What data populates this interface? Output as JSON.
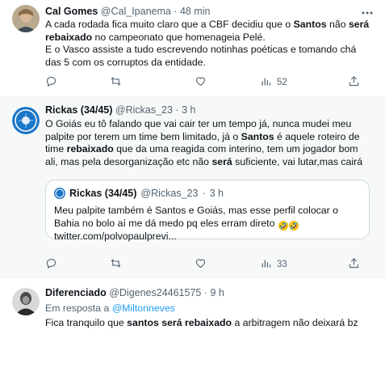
{
  "tweets": [
    {
      "name": "Cal Gomes",
      "handle": "@Cal_Ipanema",
      "sep": "·",
      "time": "48 min",
      "paragraphs": [
        [
          {
            "t": "A cada rodada fica muito claro que a CBF decidiu que o "
          },
          {
            "t": "Santos",
            "b": true
          },
          {
            "t": " não "
          },
          {
            "t": "será",
            "b": true
          },
          {
            "t": " "
          },
          {
            "t": "rebaixado",
            "b": true
          },
          {
            "t": " no campeonato que homenageia Pelé."
          }
        ],
        [
          {
            "t": "E o Vasco assiste a tudo escrevendo notinhas poéticas e tomando chá das 5 com os corruptos da entidade."
          }
        ]
      ],
      "counts": {
        "reply": "",
        "retweet": "",
        "like": "",
        "views": "52"
      }
    },
    {
      "name": "Rickas (34/45)",
      "handle": "@Rickas_23",
      "sep": "·",
      "time": "3 h",
      "paragraphs": [
        [
          {
            "t": "O Goiás eu tô falando que vai cair ter um tempo já, nunca mudei meu palpite por terem um time bem limitado, já o "
          },
          {
            "t": "Santos",
            "b": true
          },
          {
            "t": " é aquele roteiro de time "
          },
          {
            "t": "rebaixado",
            "b": true
          },
          {
            "t": " que da uma reagida com interino, tem um jogador bom ali, mas pela desorganização etc não "
          },
          {
            "t": "será",
            "b": true
          },
          {
            "t": " suficiente, vai lutar,mas cairá"
          }
        ]
      ],
      "quote": {
        "name": "Rickas (34/45)",
        "handle": "@Rickas_23",
        "sep": "·",
        "time": "3 h",
        "text": "Meu palpite também é Santos e Goiás, mas esse perfil colocar o Bahia no bolo aí me dá medo pq eles erram direto ",
        "emoji": [
          "🤣",
          "🤣"
        ],
        "link": "twitter.com/polvopaulprevi..."
      },
      "counts": {
        "reply": "",
        "retweet": "",
        "like": "",
        "views": "33"
      }
    },
    {
      "name": "Diferenciado",
      "handle": "@Digenes24461575",
      "sep": "·",
      "time": "9 h",
      "reply_prefix": "Em resposta a ",
      "reply_to": "@Miltonneves",
      "paragraphs": [
        [
          {
            "t": "Fica tranquilo que "
          },
          {
            "t": "santos",
            "b": true
          },
          {
            "t": " "
          },
          {
            "t": "será",
            "b": true
          },
          {
            "t": " "
          },
          {
            "t": "rebaixado",
            "b": true
          },
          {
            "t": " a arbitragem não deixará bz"
          }
        ]
      ]
    }
  ],
  "icons": {
    "more": "more-icon",
    "reply": "reply-icon",
    "retweet": "retweet-icon",
    "like": "heart-icon",
    "views": "views-icon",
    "share": "share-icon"
  },
  "colors": {
    "accent": "#1d9bf0",
    "text": "#0f1419",
    "muted": "#536471",
    "border": "#cfd9de"
  }
}
